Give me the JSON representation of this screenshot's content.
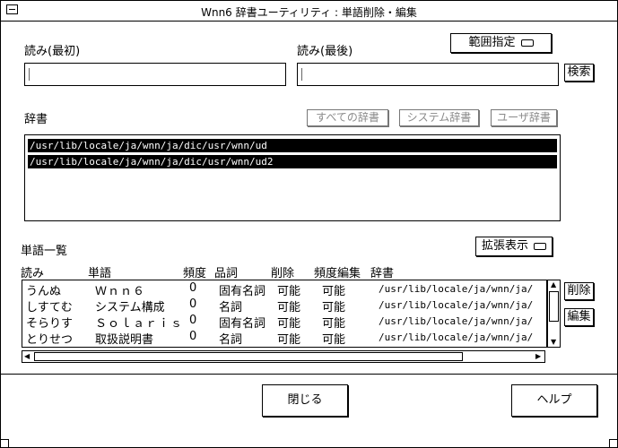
{
  "window": {
    "title": "Wnn6 辞書ユーティリティ : 単語削除・編集"
  },
  "reading_start": {
    "label": "読み(最初)",
    "value": ""
  },
  "reading_end": {
    "label": "読み(最後)",
    "value": ""
  },
  "range_button": "範囲指定",
  "search_button": "検索",
  "dictionary": {
    "label": "辞書",
    "all_button": "すべての辞書",
    "system_button": "システム辞書",
    "user_button": "ユーザ辞書",
    "items": [
      "/usr/lib/locale/ja/wnn/ja/dic/usr/wnn/ud",
      "/usr/lib/locale/ja/wnn/ja/dic/usr/wnn/ud2"
    ]
  },
  "wordlist": {
    "label": "単語一覧",
    "expand_button": "拡張表示",
    "columns": [
      "読み",
      "単語",
      "頻度",
      "品詞",
      "削除",
      "頻度編集",
      "辞書"
    ],
    "rows": [
      [
        "うんぬ",
        "Ｗｎｎ６",
        "0",
        "固有名詞",
        "可能",
        "可能",
        "/usr/lib/locale/ja/wnn/ja/"
      ],
      [
        "しすてむ",
        "システム構成",
        "0",
        "名詞",
        "可能",
        "可能",
        "/usr/lib/locale/ja/wnn/ja/"
      ],
      [
        "そらりす",
        "Ｓｏｌａｒｉｓ",
        "0",
        "固有名詞",
        "可能",
        "可能",
        "/usr/lib/locale/ja/wnn/ja/"
      ],
      [
        "とりせつ",
        "取扱説明書",
        "0",
        "名詞",
        "可能",
        "可能",
        "/usr/lib/locale/ja/wnn/ja/"
      ]
    ],
    "delete_button": "削除",
    "edit_button": "編集"
  },
  "footer": {
    "close_button": "閉じる",
    "help_button": "ヘルプ"
  }
}
